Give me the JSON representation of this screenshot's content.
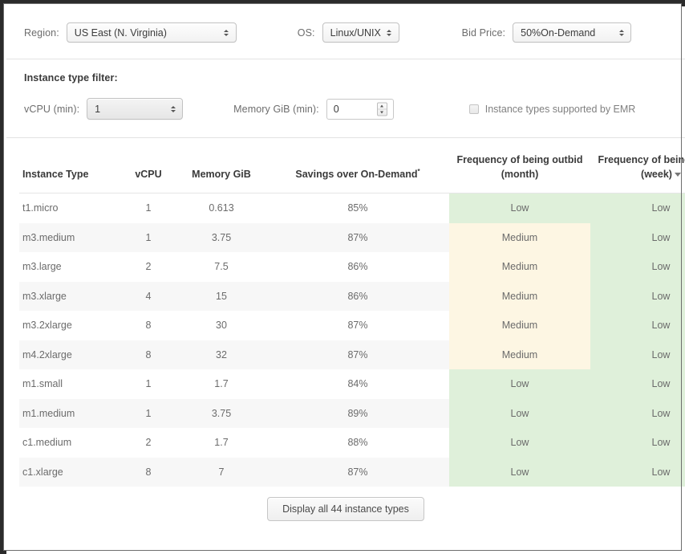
{
  "topbar": {
    "region": {
      "label": "Region:",
      "value": "US East (N. Virginia)"
    },
    "os": {
      "label": "OS:",
      "value": "Linux/UNIX"
    },
    "bid_price": {
      "label": "Bid Price:",
      "value": "50%On-Demand"
    }
  },
  "filter": {
    "title": "Instance type filter:",
    "vcpu": {
      "label": "vCPU (min):",
      "value": "1"
    },
    "memory": {
      "label": "Memory GiB (min):",
      "value": "0"
    },
    "emr": {
      "label": "Instance types supported by EMR",
      "checked": false
    }
  },
  "table": {
    "headers": {
      "instance_type": "Instance Type",
      "vcpu": "vCPU",
      "memory": "Memory GiB",
      "savings": "Savings over On-Demand",
      "savings_sup": "*",
      "freq_month": "Frequency of being outbid (month)",
      "freq_week": "Frequency of being outbid (week)"
    },
    "rows": [
      {
        "type": "t1.micro",
        "vcpu": "1",
        "memory": "0.613",
        "savings": "85%",
        "month": "Low",
        "week": "Low"
      },
      {
        "type": "m3.medium",
        "vcpu": "1",
        "memory": "3.75",
        "savings": "87%",
        "month": "Medium",
        "week": "Low"
      },
      {
        "type": "m3.large",
        "vcpu": "2",
        "memory": "7.5",
        "savings": "86%",
        "month": "Medium",
        "week": "Low"
      },
      {
        "type": "m3.xlarge",
        "vcpu": "4",
        "memory": "15",
        "savings": "86%",
        "month": "Medium",
        "week": "Low"
      },
      {
        "type": "m3.2xlarge",
        "vcpu": "8",
        "memory": "30",
        "savings": "87%",
        "month": "Medium",
        "week": "Low"
      },
      {
        "type": "m4.2xlarge",
        "vcpu": "8",
        "memory": "32",
        "savings": "87%",
        "month": "Medium",
        "week": "Low"
      },
      {
        "type": "m1.small",
        "vcpu": "1",
        "memory": "1.7",
        "savings": "84%",
        "month": "Low",
        "week": "Low"
      },
      {
        "type": "m1.medium",
        "vcpu": "1",
        "memory": "3.75",
        "savings": "89%",
        "month": "Low",
        "week": "Low"
      },
      {
        "type": "c1.medium",
        "vcpu": "2",
        "memory": "1.7",
        "savings": "88%",
        "month": "Low",
        "week": "Low"
      },
      {
        "type": "c1.xlarge",
        "vcpu": "8",
        "memory": "7",
        "savings": "87%",
        "month": "Low",
        "week": "Low"
      }
    ]
  },
  "footer": {
    "display_all_label": "Display all 44 instance types"
  },
  "colors": {
    "freq_low_bg": "#dff0da",
    "freq_medium_bg": "#fdf6e3",
    "row_even_bg": "#f7f7f7",
    "row_odd_bg": "#ffffff",
    "text": "#6b6b6b",
    "header_text": "#3a3a3a"
  }
}
